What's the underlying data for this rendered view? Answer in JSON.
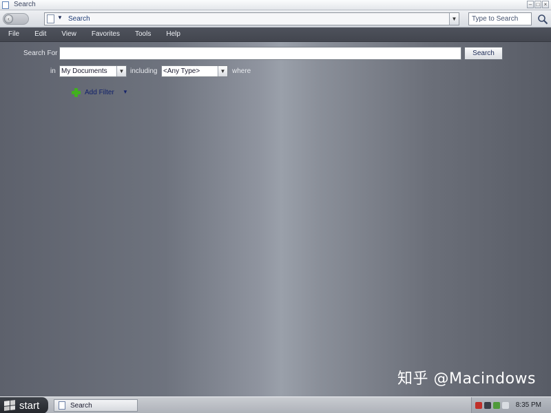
{
  "window": {
    "title": "Search"
  },
  "address_bar": {
    "location": "Search",
    "search_placeholder": "Type to Search"
  },
  "menu": {
    "items": [
      "File",
      "Edit",
      "View",
      "Favorites",
      "Tools",
      "Help"
    ]
  },
  "search_form": {
    "search_for_label": "Search For",
    "search_for_value": "",
    "search_button_label": "Search",
    "in_label": "in",
    "location_selected": "My Documents",
    "including_label": "including",
    "type_selected": "<Any Type>",
    "where_label": "where",
    "add_filter_label": "Add Filter"
  },
  "watermark": "知乎 @Macindows",
  "taskbar": {
    "start_label": "start",
    "task_items": [
      "Search"
    ],
    "clock": "8:35 PM"
  },
  "colors": {
    "accent_link": "#10206a",
    "plus_green": "#41b01e",
    "menubar_bg": "#4a4d56"
  }
}
